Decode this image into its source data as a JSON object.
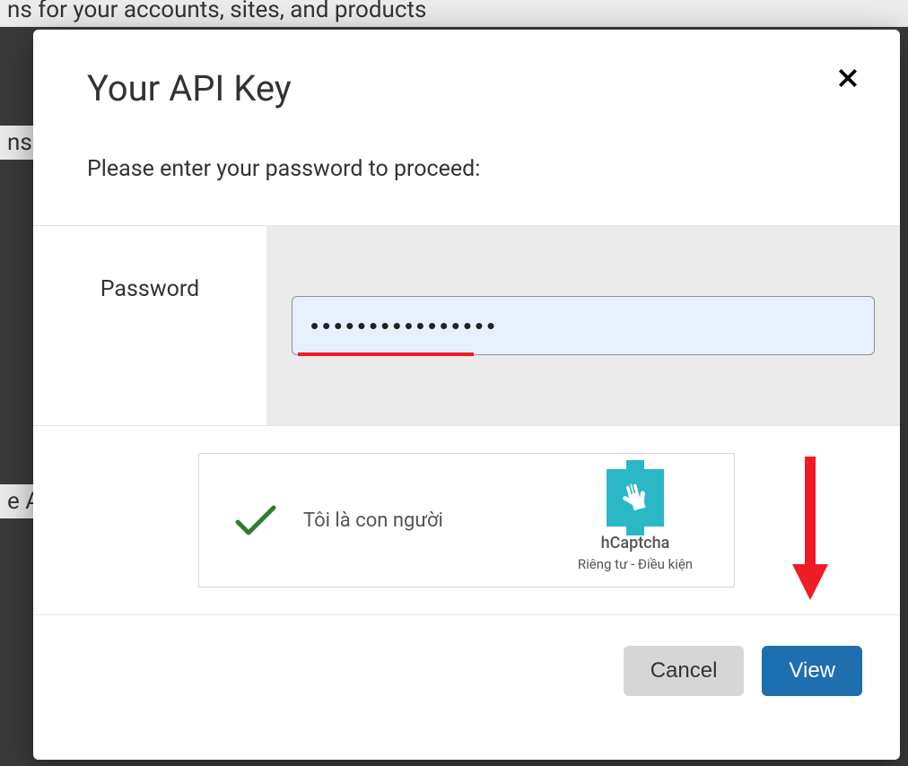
{
  "background": {
    "text1": "ns for your accounts, sites, and products",
    "text2": "ns",
    "text3": "e A"
  },
  "modal": {
    "title": "Your API Key",
    "subtitle": "Please enter your password to proceed:",
    "form": {
      "label": "Password",
      "value": "••••••••••••••••"
    },
    "captcha": {
      "label": "Tôi là con người",
      "brand": "hCaptcha",
      "links": "Riêng tư - Điều kiện"
    },
    "footer": {
      "cancel": "Cancel",
      "view": "View"
    }
  }
}
